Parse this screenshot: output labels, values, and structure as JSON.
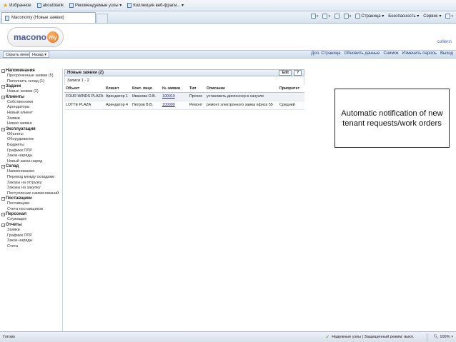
{
  "browser": {
    "favorites_label": "Избранное",
    "favorites": [
      "aboutblank",
      "Рекомендуемые узлы ▾",
      "Коллекция веб-фрагм... ▾"
    ],
    "tab_title": "Maconomy (Новые заявки)",
    "tools": [
      "Страница ▾",
      "Безопасность ▾",
      "Сервис ▾"
    ],
    "help_icon": "?",
    "status_left": "Готово",
    "status_zone": "Надежные узлы | Защищенный режим: выкл.",
    "zoom": "100%"
  },
  "app": {
    "logo_text": "macono",
    "logo_ball": "my",
    "user": "colliers\\",
    "hide_menu": "Скрыть меню",
    "back": "Назад ▾",
    "top_links": [
      "Доп. Страница",
      "Обновить данные",
      "Снимок",
      "Изменить пароль",
      "Выход"
    ],
    "sidebar": [
      {
        "title": "Напоминания",
        "items": [
          "Просроченные заявки (5)",
          "Пополнить склад (1)"
        ]
      },
      {
        "title": "Задачи",
        "items": [
          "Новые заявки (2)"
        ]
      },
      {
        "title": "Клиенты",
        "items": [
          "Собственники",
          "Арендаторы",
          "Новый клиент",
          "Заявки",
          "Новая заявка"
        ]
      },
      {
        "title": "Эксплуатация",
        "items": [
          "Объекты",
          "Оборудование",
          "Бюджеты",
          "Графики ППР",
          "Заказ-наряды",
          "Новый заказ-наряд"
        ]
      },
      {
        "title": "Склад",
        "items": [
          "Наименования",
          "Перевод между складами",
          "Заказы на отгрузку",
          "Заказы на закупку",
          "Поступление наименований"
        ]
      },
      {
        "title": "Поставщики",
        "items": [
          "Поставщики",
          "Счета поставщиков"
        ]
      },
      {
        "title": "Персонал",
        "items": [
          "Служащие"
        ]
      },
      {
        "title": "Отчеты",
        "items": [
          "Заявки",
          "Графики ППР",
          "Заказ-наряды",
          "Счета"
        ]
      }
    ],
    "panel": {
      "title": "Новые заявки (2)",
      "edit": "Edit",
      "help": "?",
      "records": "Записи 1 - 2",
      "columns": [
        "Объект",
        "Клиент",
        "Конт. лицо",
        "№ заявки",
        "Тип",
        "Описание",
        "Приоритет"
      ],
      "rows": [
        [
          "FOUR WINDS PLAZA",
          "Арендатор 1",
          "Иванова О.В.",
          "100010",
          "Прочее",
          "установить диспенсер в санузле",
          ""
        ],
        [
          "LOTTE PLAZA",
          "Арендатор 4",
          "Петров В.В.",
          "100009",
          "Ремонт",
          "ремонт электронного замка офиса 55",
          "Средний"
        ]
      ]
    }
  },
  "callout": "Automatic notification of new tenant requests/work orders"
}
